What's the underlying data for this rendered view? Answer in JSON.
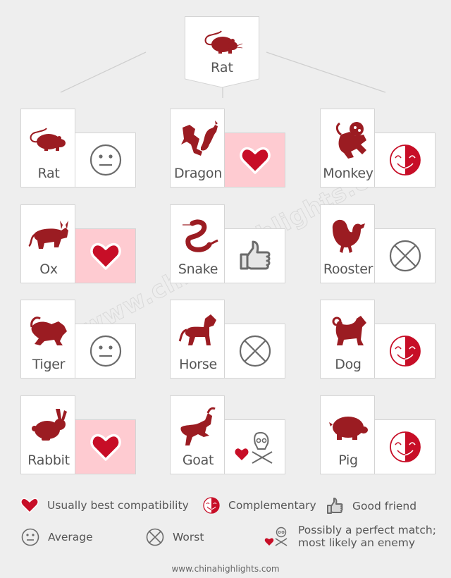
{
  "title_animal": {
    "name": "Rat",
    "icon": "rat-icon"
  },
  "colors": {
    "background": "#eeeeee",
    "animal_red": "#9b1c22",
    "heart_red": "#c70e27",
    "pink_cell": "#fecbd1",
    "icon_gray": "#6b6b6b",
    "card_border": "#d4d4d4"
  },
  "matches": [
    {
      "animal": "Rat",
      "icon": "rat-icon",
      "rating": "average"
    },
    {
      "animal": "Dragon",
      "icon": "dragon-icon",
      "rating": "best"
    },
    {
      "animal": "Monkey",
      "icon": "monkey-icon",
      "rating": "complementary"
    },
    {
      "animal": "Ox",
      "icon": "ox-icon",
      "rating": "best"
    },
    {
      "animal": "Snake",
      "icon": "snake-icon",
      "rating": "good-friend"
    },
    {
      "animal": "Rooster",
      "icon": "rooster-icon",
      "rating": "worst"
    },
    {
      "animal": "Tiger",
      "icon": "tiger-icon",
      "rating": "average"
    },
    {
      "animal": "Horse",
      "icon": "horse-icon",
      "rating": "worst"
    },
    {
      "animal": "Dog",
      "icon": "dog-icon",
      "rating": "complementary"
    },
    {
      "animal": "Rabbit",
      "icon": "rabbit-icon",
      "rating": "best"
    },
    {
      "animal": "Goat",
      "icon": "goat-icon",
      "rating": "perfect-or-enemy"
    },
    {
      "animal": "Pig",
      "icon": "pig-icon",
      "rating": "complementary"
    }
  ],
  "legend": {
    "best": "Usually best compatibility",
    "complementary": "Complementary",
    "good_friend": "Good friend",
    "average": "Average",
    "worst": "Worst",
    "perfect_or_enemy_line1": "Possibly a perfect match;",
    "perfect_or_enemy_line2": "most likely an enemy"
  },
  "watermark": "www.chinahighlights.com",
  "footer": "www.chinahighlights.com"
}
